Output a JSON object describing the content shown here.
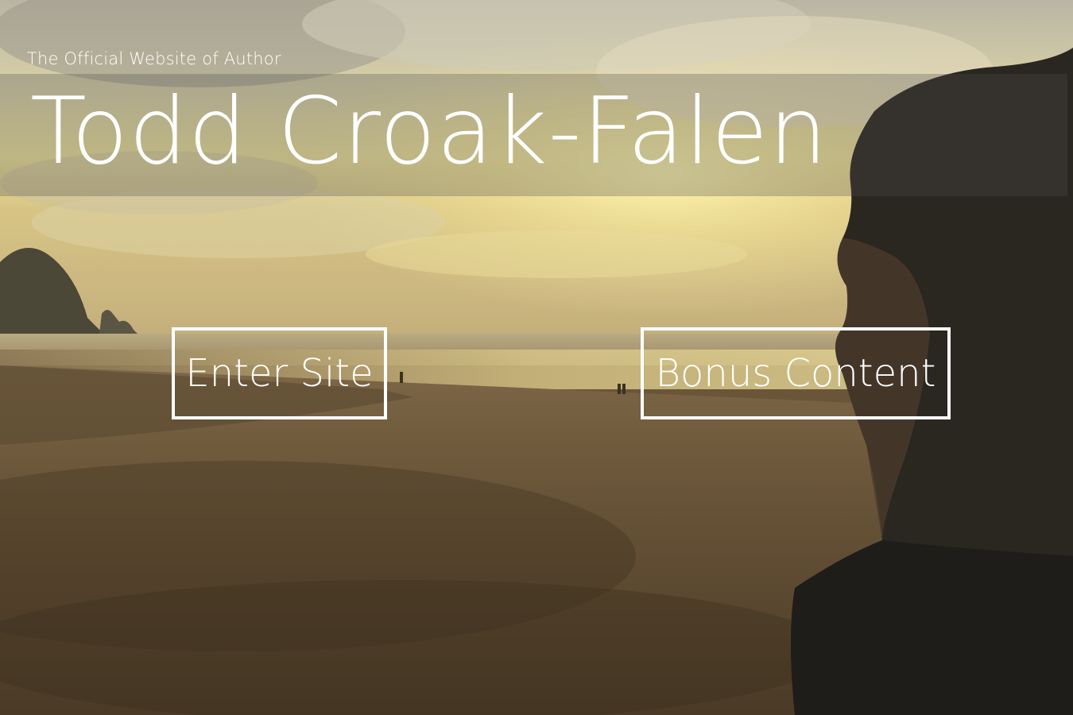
{
  "header": {
    "tagline": "The Official Website of Author",
    "title": "Todd Croak-Falen"
  },
  "actions": {
    "enter_label": "Enter Site",
    "bonus_label": "Bonus Content"
  },
  "colors": {
    "text": "#ffffff",
    "button_border": "#ffffff",
    "band_overlay": "rgba(80,80,80,0.30)"
  },
  "background": {
    "description_icon": "beach-sunset-photo"
  }
}
